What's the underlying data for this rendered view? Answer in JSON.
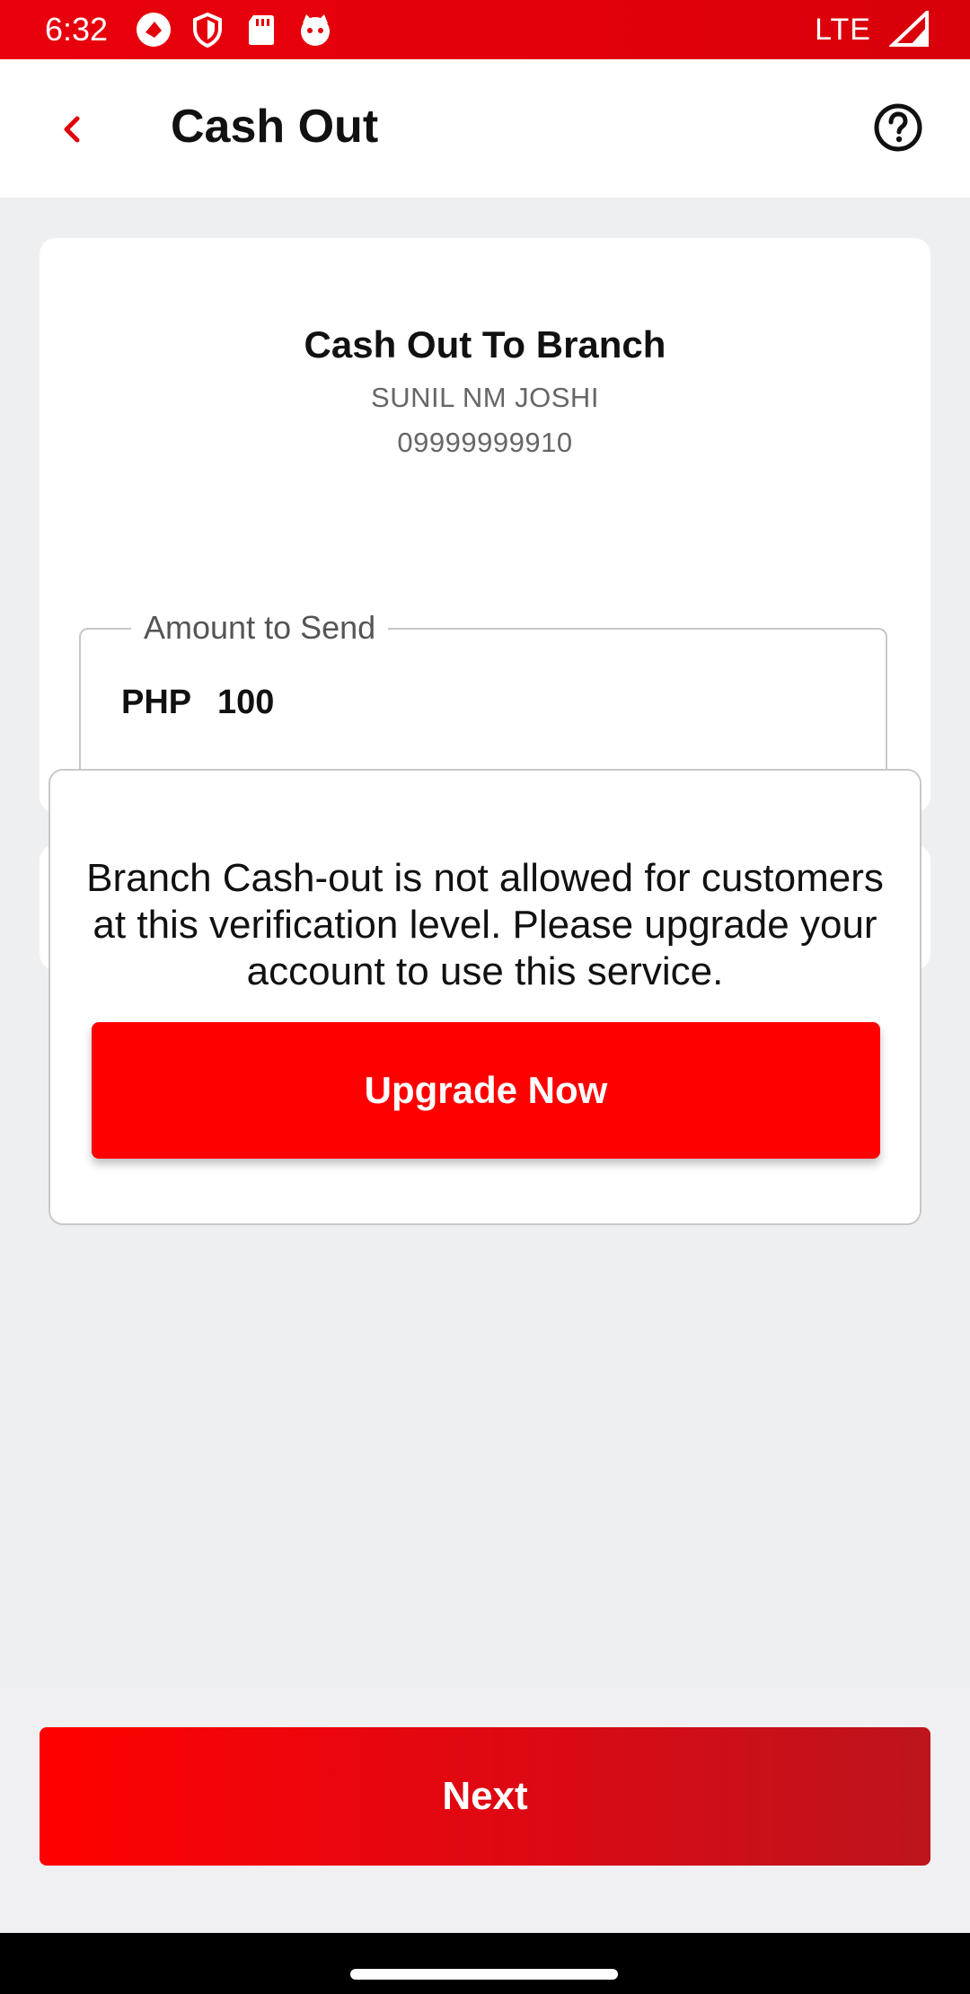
{
  "status_bar": {
    "time": "6:32",
    "network": "LTE",
    "icons": [
      "app-icon",
      "shield-icon",
      "sd-card-icon",
      "cat-face-icon",
      "signal-icon"
    ]
  },
  "header": {
    "title": "Cash Out",
    "back_icon": "chevron-left-icon",
    "help_icon": "help-circle-icon"
  },
  "card": {
    "title": "Cash Out To Branch",
    "name": "SUNIL NM JOSHI",
    "phone": "09999999910",
    "amount": {
      "label": "Amount to Send",
      "currency": "PHP",
      "value": "100"
    }
  },
  "dialog": {
    "message": "Branch Cash-out is not allowed for customers at this verification level. Please upgrade your account to use this service.",
    "button_label": "Upgrade Now"
  },
  "footer": {
    "next_label": "Next"
  },
  "colors": {
    "accent": "#ff0000",
    "status_bar": "#e2000a"
  }
}
